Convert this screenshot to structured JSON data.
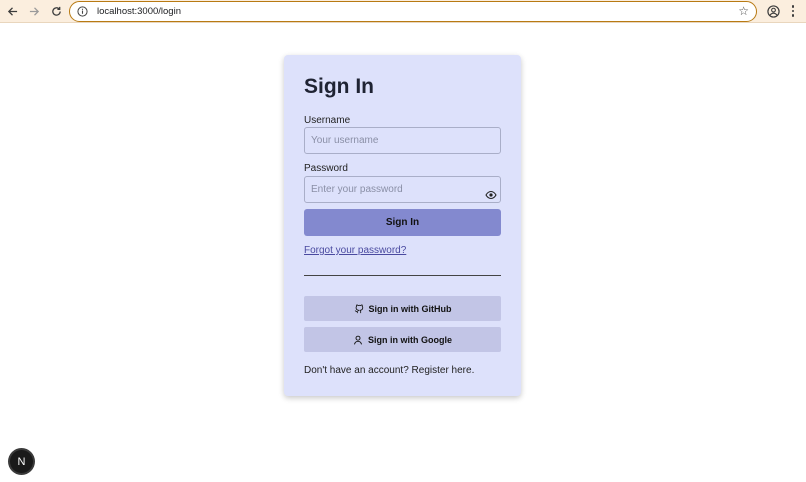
{
  "browser": {
    "url": "localhost:3000/login",
    "icons": [
      "back-arrow-icon",
      "forward-arrow-icon",
      "reload-icon",
      "site-info-icon",
      "bookmark-star-icon",
      "profile-icon",
      "more-menu-icon"
    ]
  },
  "login": {
    "title": "Sign In",
    "username_label": "Username",
    "username_placeholder": "Your username",
    "password_label": "Password",
    "password_placeholder": "Enter your password",
    "submit_label": "Sign In",
    "forgot_link": "Forgot your password?",
    "github_label": "Sign in with GitHub",
    "google_label": "Sign in with Google",
    "register_text": "Don't have an account? Register here."
  },
  "dev_indicator": {
    "label": "N"
  },
  "colors": {
    "card_background": "#dde1fb",
    "primary_button": "#8389cf",
    "social_button": "#c2c5e6",
    "browser_bar": "#fbeede",
    "url_focus_border": "#b87a13"
  }
}
